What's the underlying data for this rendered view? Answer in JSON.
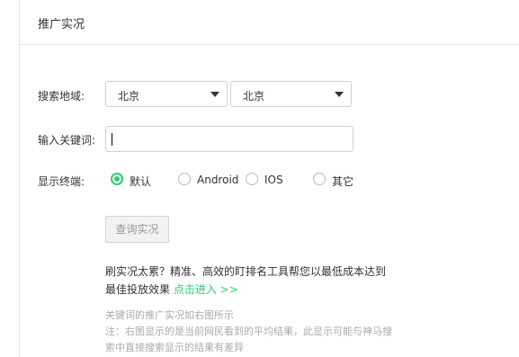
{
  "header": {
    "title": "推广实况"
  },
  "region": {
    "label": "搜索地域:",
    "province": "北京",
    "city": "北京"
  },
  "keyword": {
    "label": "输入关键词:",
    "value": ""
  },
  "terminal": {
    "label": "显示终端:",
    "options": [
      {
        "label": "默认",
        "checked": true
      },
      {
        "label": "Android",
        "checked": false
      },
      {
        "label": "IOS",
        "checked": false
      },
      {
        "label": "其它",
        "checked": false
      }
    ]
  },
  "query_button": "查询实况",
  "promo": {
    "text": "刷实况太累？精准、高效的盯排名工具帮您以最低成本达到最佳投放效果",
    "link": "点击进入 >>"
  },
  "notes": {
    "line1": "关键词的推广实况如右图所示",
    "line2": "注：右图显示的是当前网民看到的平均结果，此显示可能与神马搜索中直接搜索显示的结果有差异"
  },
  "colors": {
    "accent": "#2ecc71",
    "border": "#cfcfcf",
    "muted": "#aaaaaa"
  }
}
